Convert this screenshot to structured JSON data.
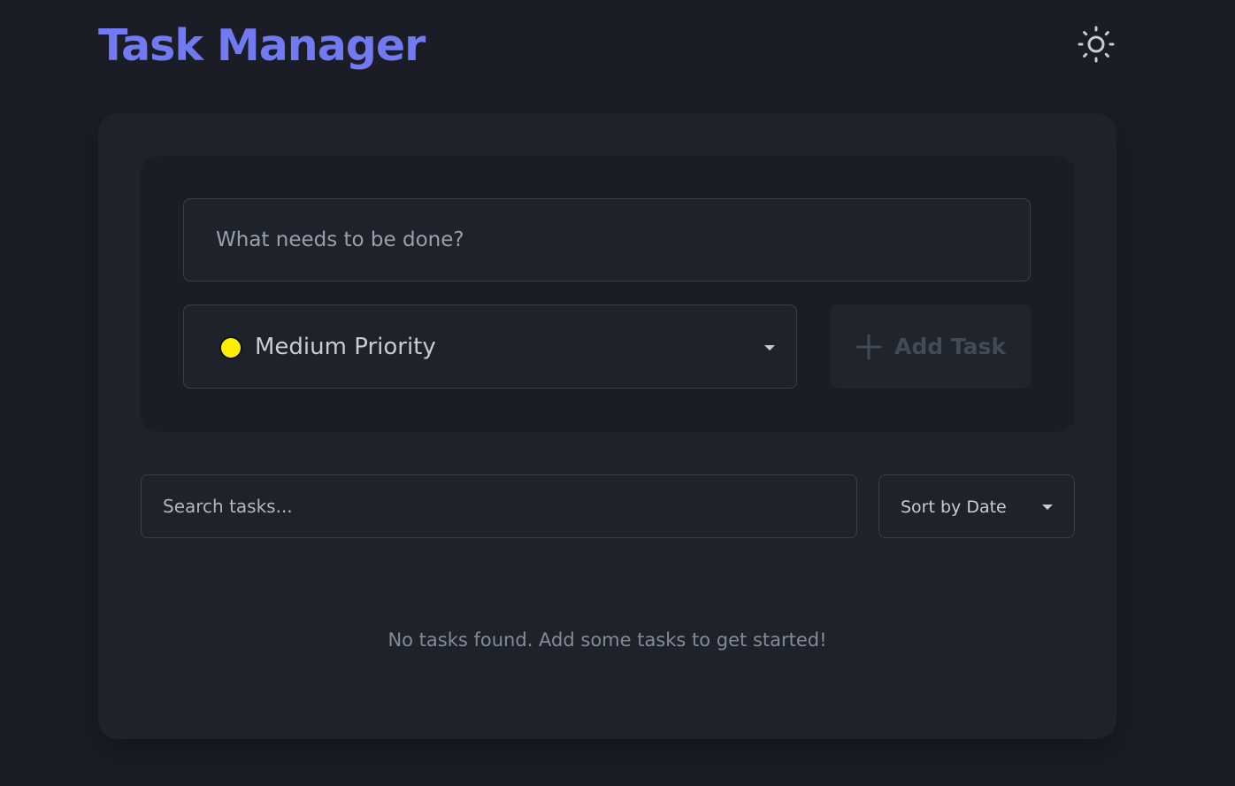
{
  "header": {
    "title": "Task Manager",
    "theme_toggle_icon": "sun-icon"
  },
  "task_form": {
    "input_placeholder": "What needs to be done?",
    "input_value": "",
    "priority": {
      "selected_label": "Medium Priority",
      "dot_color": "#ffee00",
      "icon": "chevron-down-icon"
    },
    "add_button": {
      "label": "Add Task",
      "icon": "plus-icon",
      "disabled": true
    }
  },
  "filters": {
    "search_placeholder": "Search tasks...",
    "search_value": "",
    "sort_selected_label": "Sort by Date"
  },
  "task_list": {
    "items": [],
    "empty_message": "No tasks found. Add some tasks to get started!"
  },
  "colors": {
    "accent": "#7179f3",
    "background": "#1a1d26",
    "card": "#1e222b"
  }
}
